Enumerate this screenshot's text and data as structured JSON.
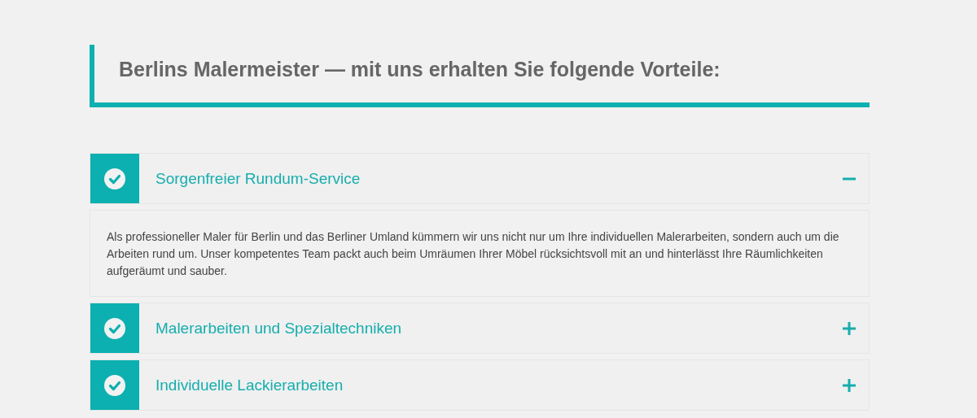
{
  "heading": "Berlins Malermeister — mit uns erhalten Sie folgende Vorteile:",
  "accordion": [
    {
      "title": "Sorgenfreier Rundum-Service",
      "expanded": true,
      "body": "Als professioneller Maler für Berlin und das Berliner Umland kümmern wir uns nicht nur um Ihre individuellen Malerarbeiten, sondern auch um die Arbeiten rund um. Unser kompetentes Team packt auch beim Umräumen Ihrer Möbel rücksichtsvoll mit an und hinterlässt Ihre Räumlichkeiten aufgeräumt und sauber."
    },
    {
      "title": "Malerarbeiten und Spezialtechniken",
      "expanded": false
    },
    {
      "title": "Individuelle Lackierarbeiten",
      "expanded": false
    }
  ]
}
